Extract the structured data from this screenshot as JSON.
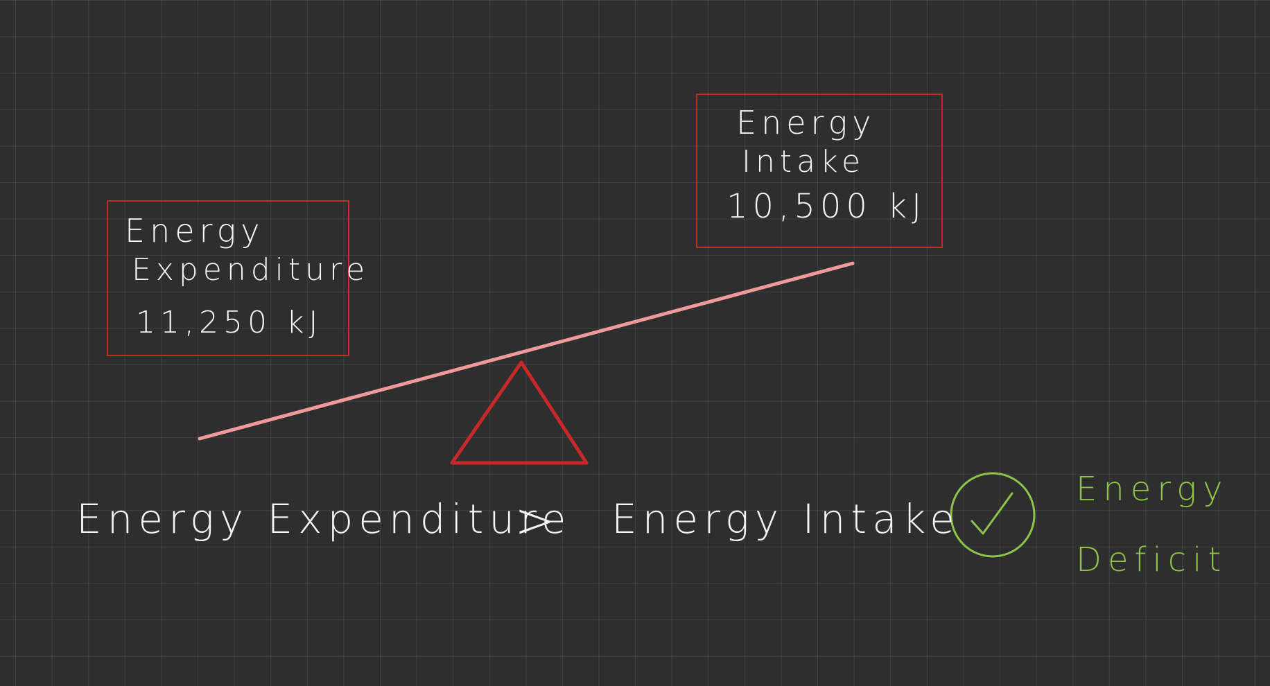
{
  "expenditure_box": {
    "line1": "Energy",
    "line2": "Expenditure",
    "value": "11,250 kJ"
  },
  "intake_box": {
    "line1": "Energy",
    "line2": "Intake",
    "value": "10,500 kJ"
  },
  "comparison": {
    "left": "Energy Expenditure",
    "symbol": ">",
    "right": "Energy Intake"
  },
  "result": {
    "line1": "Energy",
    "line2": "Deficit"
  },
  "colors": {
    "background": "#2e2e2e",
    "box_border": "#c8282a",
    "beam": "#f19a9c",
    "fulcrum": "#c8282a",
    "text": "#f4f4f4",
    "result": "#8fc44a"
  },
  "icons": [
    "checkmark-circle-icon"
  ]
}
